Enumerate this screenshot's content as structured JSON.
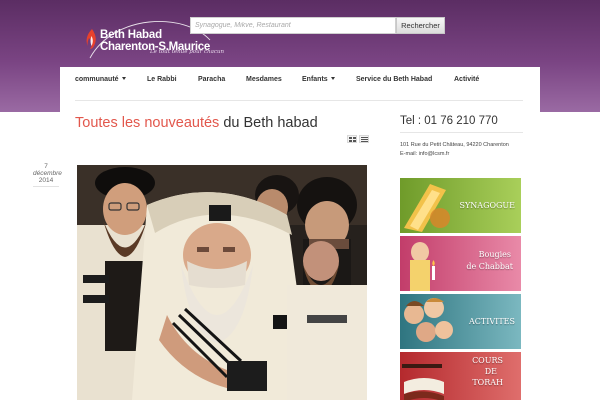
{
  "header": {
    "logo": {
      "line1": "Beth Habad",
      "line2": "Charenton-S.Maurice",
      "tagline": "Le tout tenue pour chacun"
    },
    "search": {
      "placeholder": "Synagogue, Mikve, Restaurant",
      "button_label": "Rechercher"
    }
  },
  "nav": {
    "items": [
      {
        "label": "communauté",
        "has_dropdown": true
      },
      {
        "label": "Le Rabbi",
        "has_dropdown": false
      },
      {
        "label": "Paracha",
        "has_dropdown": false
      },
      {
        "label": "Mesdames",
        "has_dropdown": false
      },
      {
        "label": "Enfants",
        "has_dropdown": true
      },
      {
        "label": "Service du Beth Habad",
        "has_dropdown": false
      },
      {
        "label": "Activité",
        "has_dropdown": false
      }
    ]
  },
  "main": {
    "title_highlight": "Toutes les nouveautés",
    "title_rest": " du Beth habad",
    "post": {
      "date_day": "7",
      "date_month": "décembre",
      "date_year": "2014"
    }
  },
  "sidebar": {
    "phone": "Tel : 01 76 210 770",
    "address": "101 Rue du Petit Château, 94220 Charenton",
    "email": "E-mail: info@lcsm.fr",
    "banners": [
      {
        "label": "SYNAGOGUE",
        "color_from": "#6f9b2a",
        "color_to": "#a9cf5a"
      },
      {
        "label_line1": "Bougies",
        "label_line2": "de Chabbat",
        "color_from": "#c23d6a",
        "color_to": "#e98aa8"
      },
      {
        "label": "ACTIVITES",
        "color_from": "#2f7580",
        "color_to": "#7bb8c0"
      },
      {
        "label_line1": "COURS",
        "label_line2": "DE",
        "label_line3": "TORAH",
        "color_from": "#b4292d",
        "color_to": "#df6e6c"
      }
    ]
  },
  "colors": {
    "header_purple": "#6b3a74",
    "title_accent": "#e2574c"
  },
  "icons": [
    "grid-view-icon",
    "list-view-icon",
    "caret-down-icon",
    "flame-logo-icon"
  ]
}
